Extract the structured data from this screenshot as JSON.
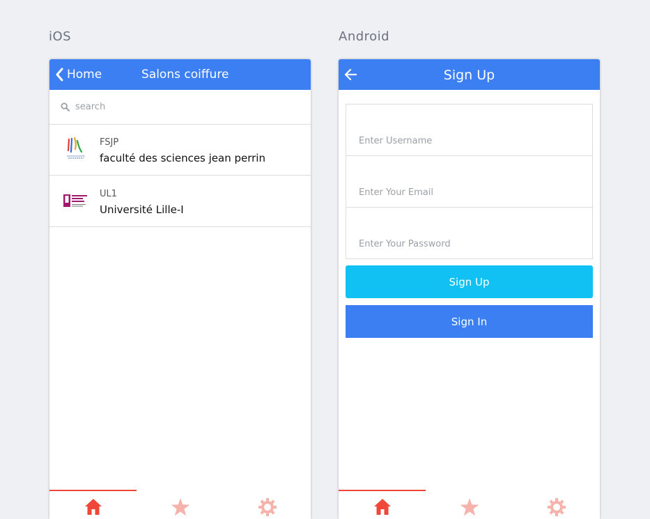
{
  "labels": {
    "ios": "iOS",
    "android": "Android"
  },
  "ios": {
    "header": {
      "back_label": "Home",
      "title": "Salons coiffure"
    },
    "search": {
      "placeholder": "search",
      "value": ""
    },
    "items": [
      {
        "subtitle": "FSJP",
        "title": "faculté des sciences jean perrin",
        "avatar": "fsjp-logo"
      },
      {
        "subtitle": "UL1",
        "title": "Université Lille-I",
        "avatar": "universite-lille-logo"
      }
    ],
    "tabs": [
      {
        "icon": "home-icon",
        "active": true
      },
      {
        "icon": "star-icon",
        "active": false
      },
      {
        "icon": "gear-icon",
        "active": false
      }
    ]
  },
  "android": {
    "header": {
      "title": "Sign Up"
    },
    "form": {
      "username_placeholder": "Enter Username",
      "email_placeholder": "Enter Your Email",
      "password_placeholder": "Enter Your Password"
    },
    "buttons": {
      "signup": "Sign Up",
      "signin": "Sign In"
    },
    "tabs": [
      {
        "icon": "home-icon",
        "active": true
      },
      {
        "icon": "star-icon",
        "active": false
      },
      {
        "icon": "gear-icon",
        "active": false
      }
    ]
  },
  "colors": {
    "header": "#3b7ff3",
    "signup_button": "#11c1f3",
    "signin_button": "#3b7ff3",
    "tab_active": "#ef473a",
    "tab_inactive": "#f5b3ac",
    "background": "#eff0f4"
  }
}
